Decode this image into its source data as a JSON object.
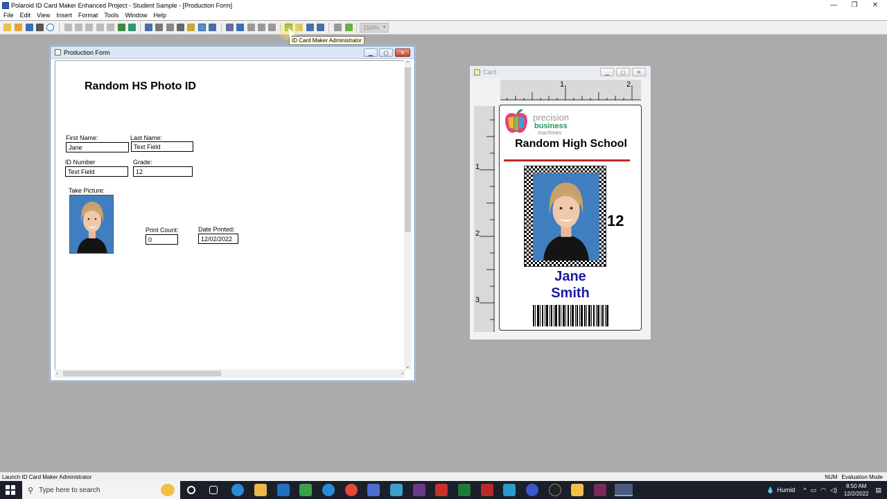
{
  "app": {
    "title": "Polaroid ID Card Maker Enhanced Project - Student Sample - [Production Form]",
    "window_controls": {
      "minimize": "—",
      "restore": "❐",
      "close": "✕"
    }
  },
  "menu": [
    "File",
    "Edit",
    "View",
    "Insert",
    "Format",
    "Tools",
    "Window",
    "Help"
  ],
  "toolbar": {
    "zoom": "150%",
    "tooltip": "ID Card Maker Administrator"
  },
  "production_form": {
    "window_title": "Production Form",
    "form_title": "Random HS Photo ID",
    "first_name_label": "First Name:",
    "first_name_value": "Jane",
    "last_name_label": "Last Name:",
    "last_name_value": "Text Field",
    "id_number_label": "ID Number",
    "id_number_value": "Text Field",
    "grade_label": "Grade:",
    "grade_value": "12",
    "take_picture_label": "Take Picture:",
    "print_count_label": "Print Count:",
    "print_count_value": "0",
    "date_printed_label": "Date Printed:",
    "date_printed_value": "12/02/2022"
  },
  "card_window": {
    "title": "Card",
    "ruler_top": [
      "1",
      "2"
    ],
    "ruler_left": [
      "1",
      "2",
      "3"
    ],
    "logo_line1": "precision",
    "logo_line2": "business",
    "logo_line3": "machines",
    "school": "Random High School",
    "grade": "12",
    "first_name": "Jane",
    "last_name": "Smith"
  },
  "statusbar": {
    "message": "Launch ID Card Maker Administrator",
    "num": "NUM",
    "mode": "Evaluation Mode"
  },
  "taskbar": {
    "search_placeholder": "Type here to search",
    "weather": "Humid",
    "time": "8:50 AM",
    "date": "12/2/2022"
  },
  "colors": {
    "accent_red": "#c0282b",
    "name_blue": "#1a1aa0",
    "photo_bg": "#3f7fbf"
  }
}
